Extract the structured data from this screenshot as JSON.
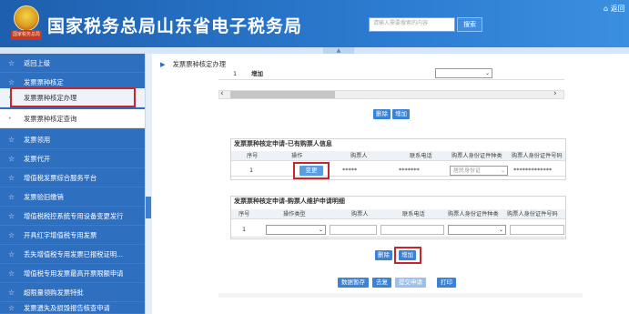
{
  "header": {
    "emblem_text": "国家税务总局",
    "site_title": "国家税务总局山东省电子税务局",
    "search_placeholder": "请输入需要搜索的内容",
    "search_button": "搜索",
    "home_link": "返回",
    "collapse_handle": "▲"
  },
  "sidebar": {
    "items": [
      {
        "label": "返回上级"
      },
      {
        "label": "发票票种核定"
      },
      {
        "label": "发票票种核定办理"
      },
      {
        "label": "发票票种核定查询"
      },
      {
        "label": "发票领用"
      },
      {
        "label": "发票代开"
      },
      {
        "label": "增值税发票综合服务平台"
      },
      {
        "label": "发票验旧缴销"
      },
      {
        "label": "增值税税控系统专用设备变更发行"
      },
      {
        "label": "开具红字增值税专用发票"
      },
      {
        "label": "丢失增值税专用发票已报税证明..."
      },
      {
        "label": "增值税专用发票最高开票限额申请"
      },
      {
        "label": "超限量领购发票特批"
      },
      {
        "label": "发票遗失及损毁报告核查申请"
      }
    ]
  },
  "main": {
    "breadcrumb": "发票票种核定办理",
    "top_row": {
      "seq": "1",
      "op": "增加"
    },
    "buttons_top": {
      "delete": "删除",
      "add": "增加"
    },
    "section1": {
      "title": "发票票种核定申请-已有购票人信息",
      "headers": [
        "序号",
        "操作",
        "购票人",
        "联系电话",
        "购票人身份证件种类",
        "购票人身份证件号码"
      ],
      "row": {
        "seq": "1",
        "action": "变更",
        "buyer": "*****",
        "phone": "*******",
        "id_type": "居民身份证",
        "id_no": "*************"
      }
    },
    "section2": {
      "title": "发票票种核定申请-购票人维护申请明细",
      "headers": [
        "序号",
        "操作类型",
        "购票人",
        "联系电话",
        "购票人身份证件种类",
        "购票人身份证件号码"
      ],
      "row": {
        "seq": "1",
        "op_type": "增加"
      }
    },
    "buttons_mid": {
      "delete": "删除",
      "add": "增加"
    },
    "buttons_bottom": [
      "数据暂存",
      "去复",
      "提交申请",
      "打印"
    ]
  }
}
